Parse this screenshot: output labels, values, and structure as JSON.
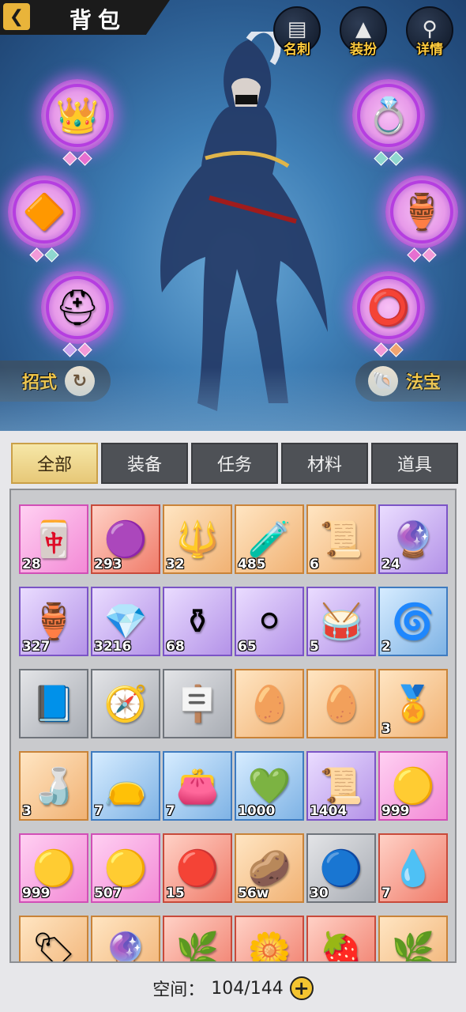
{
  "header": {
    "title": "背包"
  },
  "top_buttons": [
    {
      "label": "名刺",
      "icon": "card-icon"
    },
    {
      "label": "装扮",
      "icon": "costume-icon"
    },
    {
      "label": "详情",
      "icon": "magnifier-icon"
    }
  ],
  "side_buttons": {
    "left": {
      "label": "招式",
      "icon": "refresh-icon"
    },
    "right": {
      "label": "法宝",
      "icon": "conch-icon"
    }
  },
  "tabs": [
    {
      "label": "全部",
      "active": true
    },
    {
      "label": "装备",
      "active": false
    },
    {
      "label": "任务",
      "active": false
    },
    {
      "label": "材料",
      "active": false
    },
    {
      "label": "道具",
      "active": false
    }
  ],
  "items": [
    {
      "qty": "28",
      "rarity": "pink",
      "icon": "jade-token-icon"
    },
    {
      "qty": "293",
      "rarity": "red",
      "icon": "dark-orb-icon"
    },
    {
      "qty": "32",
      "rarity": "orange",
      "icon": "golden-crest-icon"
    },
    {
      "qty": "485",
      "rarity": "orange",
      "icon": "teal-potion-icon"
    },
    {
      "qty": "6",
      "rarity": "orange",
      "icon": "talisman-icon"
    },
    {
      "qty": "24",
      "rarity": "purple",
      "icon": "crystal-ball-icon"
    },
    {
      "qty": "327",
      "rarity": "purple",
      "icon": "porcelain-vase-icon"
    },
    {
      "qty": "3216",
      "rarity": "purple",
      "icon": "blue-crystal-icon"
    },
    {
      "qty": "68",
      "rarity": "purple",
      "icon": "incense-burner-icon"
    },
    {
      "qty": "65",
      "rarity": "purple",
      "icon": "white-pearl-icon"
    },
    {
      "qty": "5",
      "rarity": "purple",
      "icon": "gong-icon"
    },
    {
      "qty": "2",
      "rarity": "blue",
      "icon": "green-vortex-icon"
    },
    {
      "qty": "",
      "rarity": "grey",
      "icon": "book-icon"
    },
    {
      "qty": "",
      "rarity": "grey",
      "icon": "compass-plate-icon"
    },
    {
      "qty": "",
      "rarity": "grey",
      "icon": "stone-tablet-icon"
    },
    {
      "qty": "",
      "rarity": "orange",
      "icon": "spiked-egg-icon"
    },
    {
      "qty": "",
      "rarity": "orange",
      "icon": "spiked-egg-icon"
    },
    {
      "qty": "3",
      "rarity": "orange",
      "icon": "battle-medal-icon"
    },
    {
      "qty": "3",
      "rarity": "orange",
      "icon": "green-gourd-icon"
    },
    {
      "qty": "7",
      "rarity": "blue",
      "icon": "blue-pouch-icon"
    },
    {
      "qty": "7",
      "rarity": "blue",
      "icon": "red-pouch-icon"
    },
    {
      "qty": "1000",
      "rarity": "blue",
      "icon": "emerald-gem-icon"
    },
    {
      "qty": "1404",
      "rarity": "purple",
      "icon": "scroll-icon"
    },
    {
      "qty": "999",
      "rarity": "pink",
      "icon": "golden-orb-icon"
    },
    {
      "qty": "999",
      "rarity": "pink",
      "icon": "golden-orb-icon"
    },
    {
      "qty": "507",
      "rarity": "pink",
      "icon": "golden-orb-icon"
    },
    {
      "qty": "15",
      "rarity": "red",
      "icon": "red-orb-icon"
    },
    {
      "qty": "56w",
      "rarity": "orange",
      "icon": "gold-nugget-icon"
    },
    {
      "qty": "30",
      "rarity": "grey",
      "icon": "teal-sphere-icon"
    },
    {
      "qty": "7",
      "rarity": "red",
      "icon": "gold-drop-icon"
    },
    {
      "qty": "",
      "rarity": "orange",
      "icon": "red-tag-icon"
    },
    {
      "qty": "",
      "rarity": "orange",
      "icon": "purple-orb-icon"
    },
    {
      "qty": "",
      "rarity": "red",
      "icon": "herb-sprout-icon"
    },
    {
      "qty": "",
      "rarity": "red",
      "icon": "blue-flower-icon"
    },
    {
      "qty": "",
      "rarity": "red",
      "icon": "fire-fruit-icon"
    },
    {
      "qty": "",
      "rarity": "orange",
      "icon": "herb-sprout-icon"
    }
  ],
  "footer": {
    "label": "空间：",
    "value": "104/144"
  }
}
